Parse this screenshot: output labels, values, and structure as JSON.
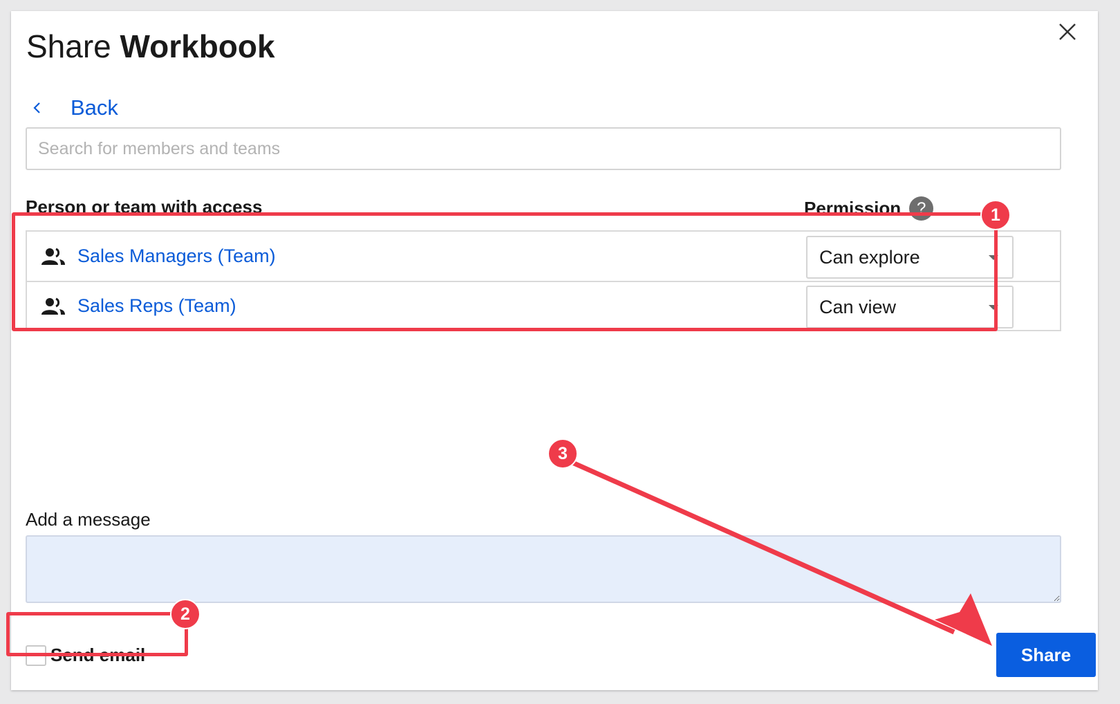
{
  "dialog": {
    "title_regular": "Share",
    "title_bold": "Workbook",
    "back_label": "Back",
    "search_placeholder": "Search for members and teams"
  },
  "access": {
    "col_person": "Person or team with access",
    "col_permission": "Permission",
    "help_glyph": "?",
    "rows": [
      {
        "name": "Sales Managers (Team)",
        "permission": "Can explore",
        "icon": "team-icon"
      },
      {
        "name": "Sales Reps (Team)",
        "permission": "Can view",
        "icon": "team-icon"
      }
    ]
  },
  "message": {
    "label": "Add a message",
    "value": ""
  },
  "footer": {
    "send_email_label": "Send email",
    "send_email_checked": false,
    "share_label": "Share"
  },
  "annotations": {
    "color": "#ef3b4a",
    "badges": [
      "1",
      "2",
      "3"
    ]
  },
  "colors": {
    "link": "#0a5bd8",
    "primary_button": "#0a5ee0",
    "message_bg": "#e6eefb"
  }
}
